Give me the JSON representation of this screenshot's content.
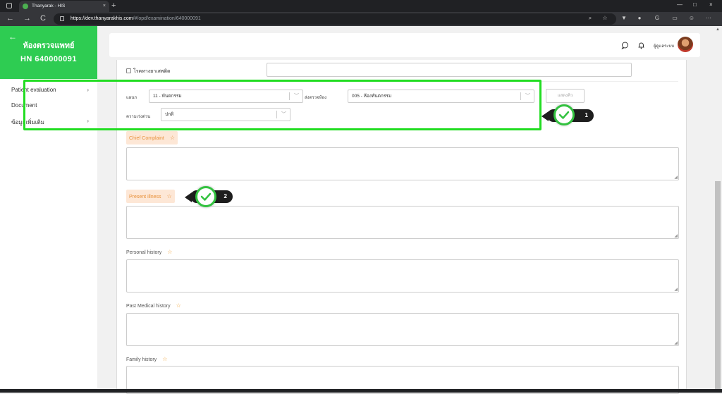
{
  "browser": {
    "tab_title": "Thanyarak - HIS",
    "tab_close": "×",
    "new_tab": "+",
    "url_host": "https://dev.thanyarakhis.com",
    "url_path": "/#/opd/examination/640000091",
    "back": "←",
    "forward": "→",
    "reload": "C",
    "minimize": "—",
    "maximize": "□",
    "close": "×"
  },
  "sidebar": {
    "back_icon": "←",
    "title": "ห้องตรวจแพทย์",
    "hn": "HN 640000091",
    "items": [
      {
        "label": "Patient evaluation",
        "chevron": "›"
      },
      {
        "label": "Document",
        "chevron": ""
      },
      {
        "label": "ข้อมูลเพิ่มเติม",
        "chevron": "›"
      }
    ]
  },
  "topbar": {
    "chat_icon": "chat-icon",
    "bell_icon": "bell-icon",
    "user_name": "ผู้ดูแลระบบ"
  },
  "form": {
    "checkbox_label": "โรคทางยาเสพติด",
    "department_label": "แผนก",
    "department_value": "11 - ทันตกรรม",
    "send_room_label": "ส่งตรวจห้อง",
    "send_room_value": "005 - ห้องทันตกรรม",
    "urgency_label": "ความเร่งด่วน",
    "urgency_value": "ปกติ",
    "show_button": "แสดงคิว",
    "sections": [
      {
        "label": "Chief Complaint",
        "star": "☆"
      },
      {
        "label": "Present illness",
        "star": "☆"
      },
      {
        "label": "Personal history",
        "star": "☆"
      },
      {
        "label": "Past Medical history",
        "star": "☆"
      },
      {
        "label": "Family history",
        "star": "☆"
      }
    ]
  },
  "markers": [
    {
      "number": "1"
    },
    {
      "number": "2"
    }
  ],
  "colors": {
    "brand_green": "#2ecc52",
    "highlight_green": "#22dd22",
    "peach": "#fde7d6",
    "accent_orange": "#e8913a"
  }
}
